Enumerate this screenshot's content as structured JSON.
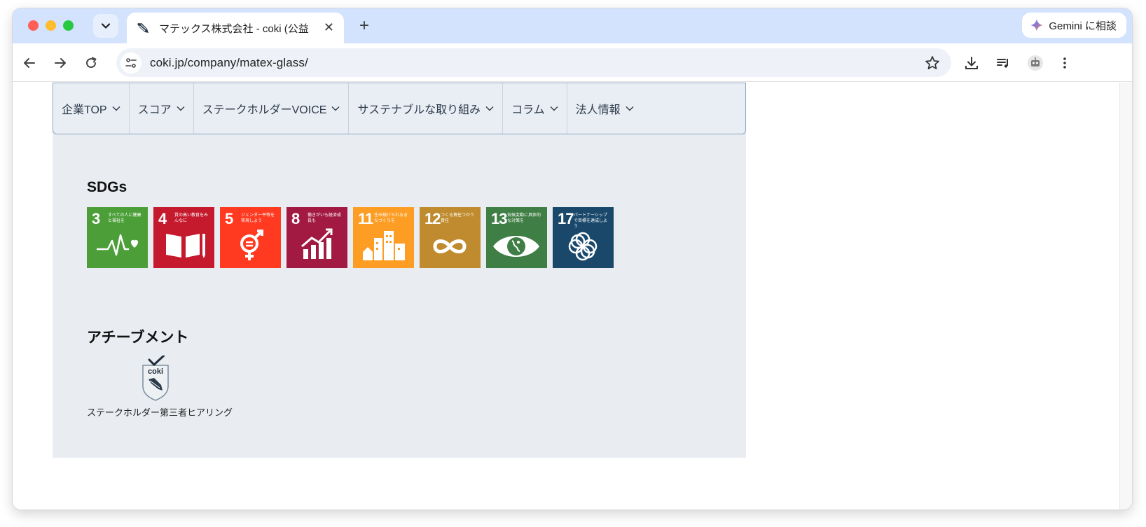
{
  "browser": {
    "tab_title": "マテックス株式会社 - coki (公益",
    "url": "coki.jp/company/matex-glass/",
    "gemini_label": "Gemini に相談",
    "new_tab_label": "+",
    "close_label": "✕"
  },
  "subnav": {
    "items": [
      {
        "label": "企業TOP"
      },
      {
        "label": "スコア"
      },
      {
        "label": "ステークホルダーVOICE"
      },
      {
        "label": "サステナブルな取り組み"
      },
      {
        "label": "コラム"
      },
      {
        "label": "法人情報"
      }
    ]
  },
  "sdgs": {
    "title": "SDGs",
    "goals": [
      {
        "number": "3",
        "caption": "すべての人に健康と福祉を",
        "color": "#4c9f38",
        "icon": "heartbeat-icon"
      },
      {
        "number": "4",
        "caption": "質の高い教育をみんなに",
        "color": "#c5192d",
        "icon": "book-icon"
      },
      {
        "number": "5",
        "caption": "ジェンダー平等を実現しよう",
        "color": "#ff3a21",
        "icon": "gender-icon"
      },
      {
        "number": "8",
        "caption": "働きがいも経済成長も",
        "color": "#a21942",
        "icon": "growth-chart-icon"
      },
      {
        "number": "11",
        "caption": "住み続けられるまちづくりを",
        "color": "#fd9d24",
        "icon": "city-icon"
      },
      {
        "number": "12",
        "caption": "つくる責任つかう責任",
        "color": "#bf8b2e",
        "icon": "infinity-icon"
      },
      {
        "number": "13",
        "caption": "気候変動に具体的な対策を",
        "color": "#3f7e44",
        "icon": "eye-globe-icon"
      },
      {
        "number": "17",
        "caption": "パートナーシップで目標を達成しよう",
        "color": "#19486a",
        "icon": "flower-rings-icon"
      }
    ]
  },
  "achievement": {
    "title": "アチーブメント",
    "badge_text": "coki",
    "badge_label": "ステークホルダー第三者ヒアリング"
  }
}
